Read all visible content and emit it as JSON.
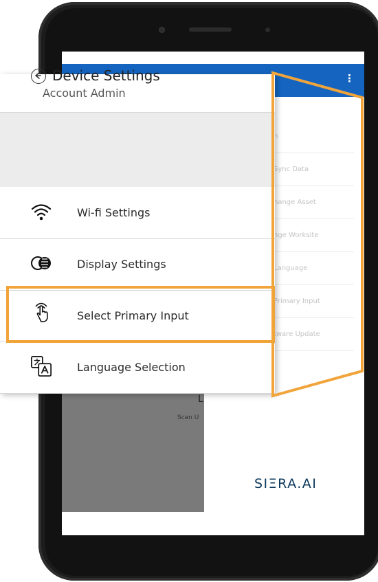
{
  "drawer": {
    "account_label": "Account Admin",
    "header_title": "Device Settings",
    "items": [
      {
        "label": "Wi-fi Settings",
        "icon": "wifi-icon"
      },
      {
        "label": "Display Settings",
        "icon": "contrast-icon"
      },
      {
        "label": "Select Primary Input",
        "icon": "touch-input-icon"
      },
      {
        "label": "Language Selection",
        "icon": "translate-icon"
      }
    ]
  },
  "background_menu": {
    "items": [
      "n",
      "Sync Data",
      "nange Asset",
      "nge Worksite",
      "Language",
      "Primary Input",
      "tware Update"
    ]
  },
  "background": {
    "scan_heading": "L",
    "scan_text": "Scan U",
    "logo": "SIΞRA.AI"
  },
  "colors": {
    "app_bar": "#1565c0",
    "highlight": "#f0a43a"
  }
}
